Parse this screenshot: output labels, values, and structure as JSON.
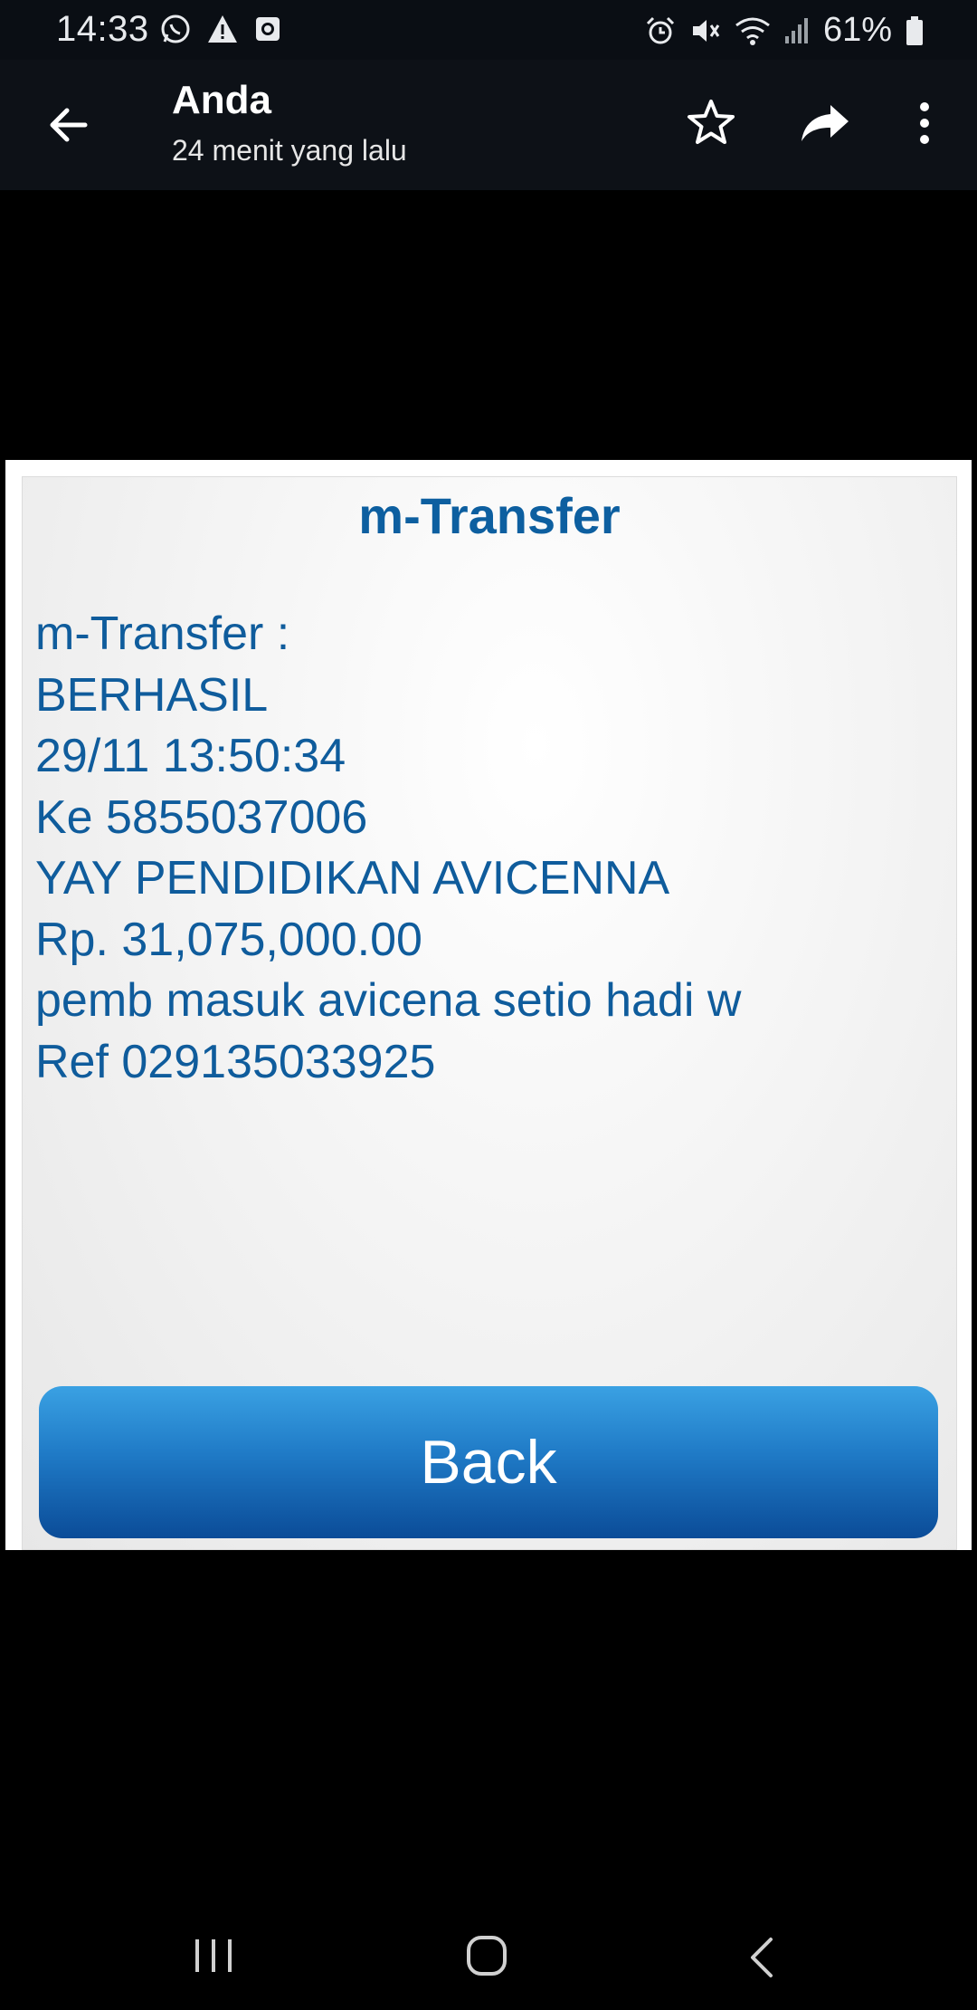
{
  "status_bar": {
    "time": "14:33",
    "left_icons": [
      "whatsapp-icon",
      "warning-icon",
      "screen-record-icon"
    ],
    "right_icons": [
      "alarm-icon",
      "mute-icon",
      "wifi-icon",
      "signal-icon",
      "battery-icon"
    ],
    "battery": "61%"
  },
  "header": {
    "title": "Anda",
    "subtitle": "24 menit yang lalu",
    "actions": [
      "star-icon",
      "share-icon",
      "more-icon"
    ]
  },
  "receipt": {
    "title": "m-Transfer",
    "lines": [
      "m-Transfer :",
      "BERHASIL",
      "29/11 13:50:34",
      "Ke 5855037006",
      "YAY PENDIDIKAN AVICENNA",
      "Rp. 31,075,000.00",
      "pemb masuk avicena setio hadi w",
      "Ref 029135033925"
    ],
    "button_label": "Back"
  },
  "colors": {
    "text_blue": "#0f5c9c",
    "button_top": "#3aa1e3",
    "button_bottom": "#0b4c98"
  }
}
